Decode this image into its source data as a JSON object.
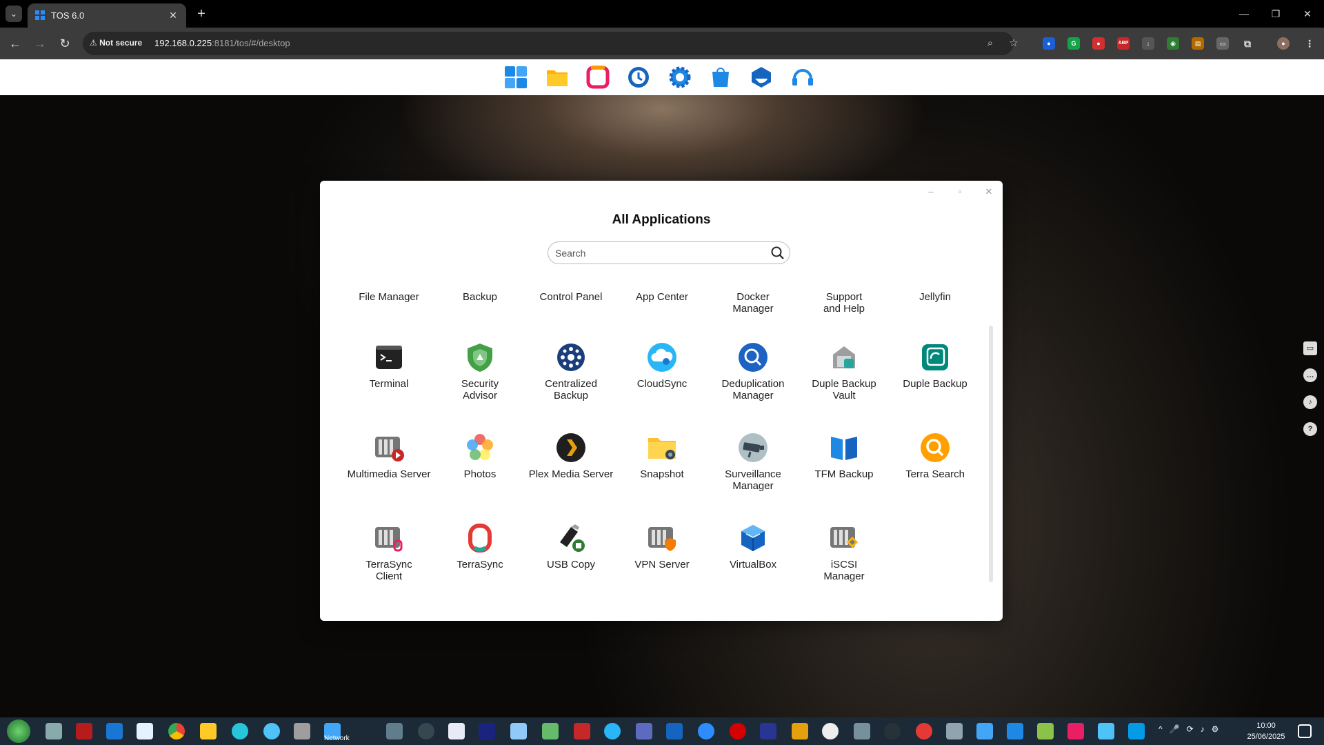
{
  "browser": {
    "tab_title": "TOS 6.0",
    "security_label": "Not secure",
    "url_host": "192.168.0.225",
    "url_rest": ":8181/tos/#/desktop"
  },
  "window": {
    "title": "All Applications",
    "search_placeholder": "Search"
  },
  "apps": {
    "row0": [
      "File Manager",
      "Backup",
      "Control Panel",
      "App Center",
      "Docker Manager",
      "Support and Help",
      "Jellyfin"
    ],
    "row1": [
      "Terminal",
      "Security Advisor",
      "Centralized Backup",
      "CloudSync",
      "Deduplication Manager",
      "Duple Backup Vault",
      "Duple Backup"
    ],
    "row2": [
      "Multimedia Server",
      "Photos",
      "Plex Media Server",
      "Snapshot",
      "Surveillance Manager",
      "TFM Backup",
      "Terra Search"
    ],
    "row3": [
      "TerraSync Client",
      "TerraSync",
      "USB Copy",
      "VPN Server",
      "VirtualBox",
      "iSCSI Manager"
    ]
  },
  "taskbar": {
    "time": "10:00",
    "date": "25/06/2025",
    "network_label": "Network"
  },
  "colors": {
    "accent": "#1e88e5",
    "window_bg": "#ffffff",
    "taskbar_bg": "#1c2a38"
  }
}
